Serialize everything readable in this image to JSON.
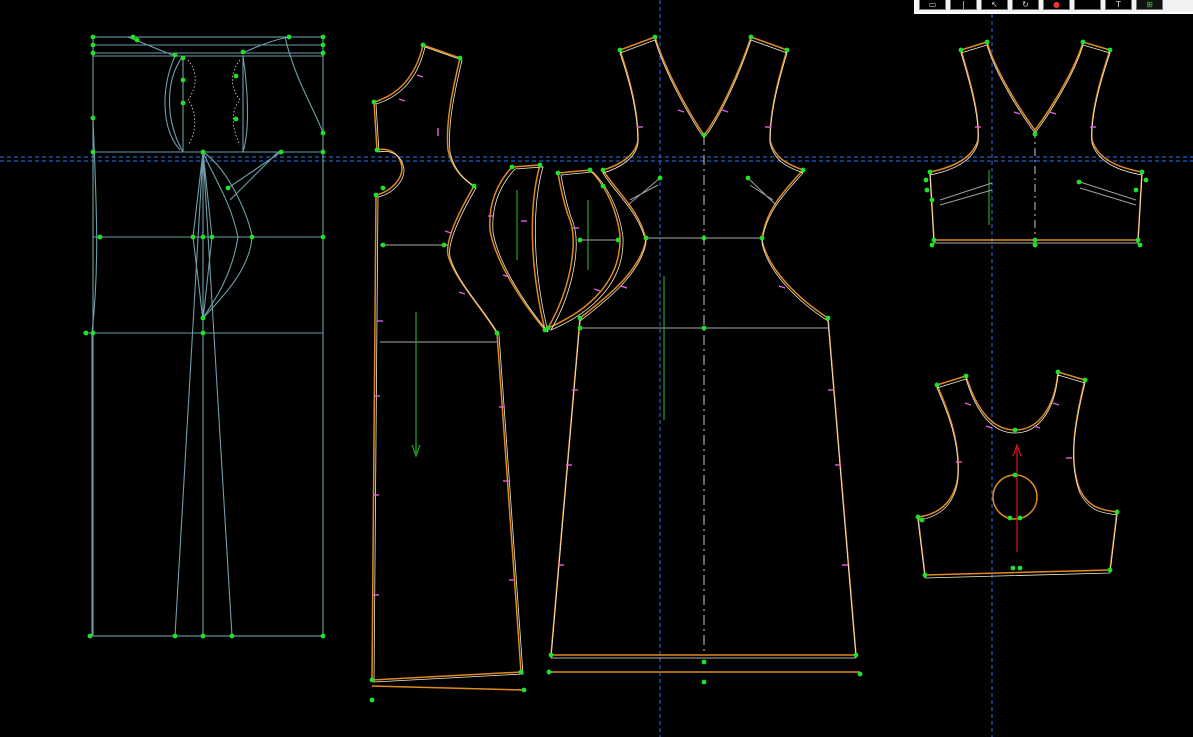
{
  "colors": {
    "background": "#000000",
    "draft_line": "#6e9ea8",
    "seam_line": "#e08a1e",
    "cut_line": "#f2ead0",
    "point": "#22e02a",
    "notch": "#e060e0",
    "grainline": "#1f9a1f",
    "guide": "#1f5fc8",
    "center_line": "#c8c8c8",
    "dart": "#9aa0a0",
    "red_grain": "#c8141a"
  },
  "toolbar": {
    "buttons": [
      {
        "name": "select-rect-icon",
        "glyph": "▭"
      },
      {
        "name": "line-tool-icon",
        "glyph": "|"
      },
      {
        "name": "pointer-icon",
        "glyph": "↖"
      },
      {
        "name": "rotate-icon",
        "glyph": "↻"
      },
      {
        "name": "red-tool-icon",
        "glyph": "●"
      },
      {
        "name": "blank-tool-icon",
        "glyph": ""
      },
      {
        "name": "text-tool-icon",
        "glyph": "T"
      },
      {
        "name": "grid-toggle-icon",
        "glyph": "⊞"
      }
    ]
  },
  "pieces": [
    {
      "name": "draft-block"
    },
    {
      "name": "side-panel-piece"
    },
    {
      "name": "bodice-panel-left-piece"
    },
    {
      "name": "bodice-panel-right-piece"
    },
    {
      "name": "front-dress-piece"
    },
    {
      "name": "front-bodice-piece"
    },
    {
      "name": "back-bodice-piece"
    }
  ]
}
